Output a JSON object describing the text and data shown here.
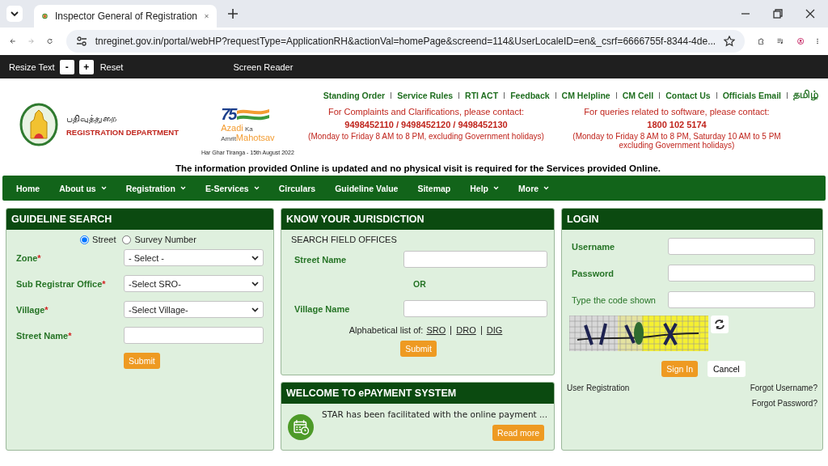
{
  "browser": {
    "tab_title": "Inspector General of Registration",
    "url": "tnreginet.gov.in/portal/webHP?requestType=ApplicationRH&actionVal=homePage&screend=114&UserLocaleID=en&_csrf=6666755f-8344-4de..."
  },
  "accessibility_bar": {
    "resize_label": "Resize Text",
    "buttons": [
      "-",
      "+"
    ],
    "reset": "Reset",
    "screen_reader": "Screen Reader"
  },
  "header": {
    "dept_tamil": "பதிவுத்துறை",
    "dept": "REGISTRATION DEPARTMENT",
    "azadi": {
      "number": "75",
      "line1": "Azadi",
      "ka": "Ka",
      "amrit": "Amrit",
      "mahotsav": "Mahotsav",
      "caption": "Har Ghar Tiranga - 15th August 2022"
    },
    "top_links": [
      "Standing Order",
      "Service Rules",
      "RTI ACT",
      "Feedback",
      "CM Helpline",
      "CM Cell",
      "Contact Us",
      "Officials Email"
    ],
    "language": "தமிழ்",
    "contacts": [
      {
        "title": "For Complaints and Clarifications, please contact:",
        "phone": "9498452110 / 9498452120 / 9498452130",
        "hours": "(Monday to Friday 8 AM to 8 PM, excluding Government holidays)"
      },
      {
        "title": "For queries related to software, please contact:",
        "phone": "1800 102 5174",
        "hours": "(Monday to Friday 8 AM to 8 PM, Saturday 10 AM to 5 PM excluding Government holidays)"
      }
    ],
    "notice": "The information provided Online is updated and no physical visit is required for the Services provided Online."
  },
  "nav": [
    {
      "label": "Home",
      "dropdown": false
    },
    {
      "label": "About us",
      "dropdown": true
    },
    {
      "label": "Registration",
      "dropdown": true
    },
    {
      "label": "E-Services",
      "dropdown": true
    },
    {
      "label": "Circulars",
      "dropdown": false
    },
    {
      "label": "Guideline Value",
      "dropdown": false
    },
    {
      "label": "Sitemap",
      "dropdown": false
    },
    {
      "label": "Help",
      "dropdown": true
    },
    {
      "label": "More",
      "dropdown": true
    }
  ],
  "guideline_search": {
    "title": "GUIDELINE SEARCH",
    "radios": [
      {
        "label": "Street",
        "selected": true
      },
      {
        "label": "Survey Number",
        "selected": false
      }
    ],
    "fields": [
      {
        "label": "Zone",
        "required_mark": "*",
        "kind": "select",
        "value": "- Select -"
      },
      {
        "label": "Sub Registrar Office",
        "required_mark": "*",
        "kind": "select",
        "value": "-Select SRO-"
      },
      {
        "label": "Village",
        "required_mark": "*",
        "kind": "select",
        "value": "-Select Village-"
      },
      {
        "label": "Street Name",
        "required_mark": "*",
        "kind": "text"
      }
    ],
    "submit": "Submit"
  },
  "jurisdiction": {
    "title": "KNOW YOUR JURISDICTION",
    "subtitle": "SEARCH FIELD OFFICES",
    "street_label": "Street Name",
    "or": "OR",
    "village_label": "Village Name",
    "alpha_label": "Alphabetical list of:",
    "alpha_links": [
      "SRO",
      "DRO",
      "DIG"
    ],
    "submit": "Submit"
  },
  "epayment": {
    "title": "WELCOME TO ePAYMENT SYSTEM",
    "text": "STAR has been facilitated with the online payment ...",
    "read_more": "Read more"
  },
  "login": {
    "title": "LOGIN",
    "fields": [
      {
        "label": "Username"
      },
      {
        "label": "Password"
      },
      {
        "label": "Type the code shown"
      }
    ],
    "sign_in": "Sign In",
    "cancel": "Cancel",
    "user_registration": "User Registration",
    "forgot_username": "Forgot Username?",
    "forgot_password": "Forgot Password?"
  }
}
